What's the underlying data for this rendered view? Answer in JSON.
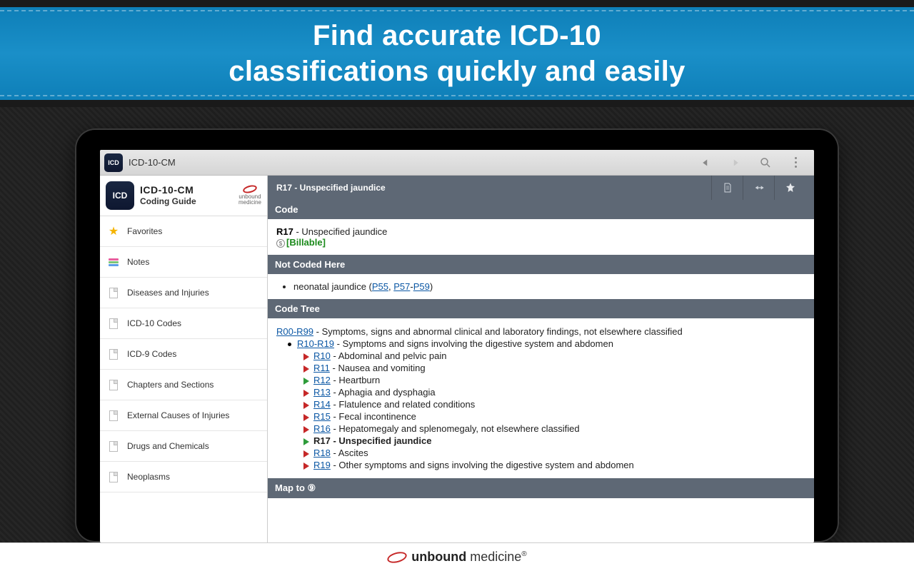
{
  "banner": {
    "line1": "Find accurate ICD-10",
    "line2": "classifications quickly and easily"
  },
  "appbar": {
    "icon_label": "ICD",
    "title": "ICD-10-CM"
  },
  "sidebar": {
    "icon_label": "ICD",
    "title": "ICD-10-CM",
    "subtitle": "Coding Guide",
    "logo_text": "unbound",
    "logo_sub": "medicine",
    "items": [
      {
        "label": "Favorites",
        "icon": "star"
      },
      {
        "label": "Notes",
        "icon": "notes"
      },
      {
        "label": "Diseases and Injuries",
        "icon": "page"
      },
      {
        "label": "ICD-10 Codes",
        "icon": "page"
      },
      {
        "label": "ICD-9 Codes",
        "icon": "page"
      },
      {
        "label": "Chapters and Sections",
        "icon": "page"
      },
      {
        "label": "External Causes of Injuries",
        "icon": "page"
      },
      {
        "label": "Drugs and Chemicals",
        "icon": "page"
      },
      {
        "label": "Neoplasms",
        "icon": "page"
      }
    ]
  },
  "topic": {
    "title": "R17 - Unspecified jaundice"
  },
  "sections": {
    "code": {
      "title": "Code",
      "code": "R17",
      "desc": " - Unspecified jaundice",
      "billable": "[Billable]"
    },
    "not_coded": {
      "title": "Not Coded Here",
      "prefix": "neonatal jaundice (",
      "links": [
        "P55",
        "P57",
        "P59"
      ],
      "sep1": ", ",
      "sep2": "-",
      "suffix": ")"
    },
    "code_tree": {
      "title": "Code Tree",
      "root": {
        "link": "R00-R99",
        "text": " - Symptoms, signs and abnormal clinical and laboratory findings, not elsewhere classified"
      },
      "sub": {
        "link": "R10-R19",
        "text": " - Symptoms and signs involving the digestive system and abdomen"
      },
      "items": [
        {
          "link": "R10",
          "text": " - Abdominal and pelvic pain",
          "color": "red"
        },
        {
          "link": "R11",
          "text": " - Nausea and vomiting",
          "color": "red"
        },
        {
          "link": "R12",
          "text": " - Heartburn",
          "color": "green"
        },
        {
          "link": "R13",
          "text": " - Aphagia and dysphagia",
          "color": "red"
        },
        {
          "link": "R14",
          "text": " - Flatulence and related conditions",
          "color": "red"
        },
        {
          "link": "R15",
          "text": " - Fecal incontinence",
          "color": "red"
        },
        {
          "link": "R16",
          "text": " - Hepatomegaly and splenomegaly, not elsewhere classified",
          "color": "red"
        },
        {
          "link": "",
          "text": "R17 - Unspecified jaundice",
          "color": "green",
          "bold": true
        },
        {
          "link": "R18",
          "text": " - Ascites",
          "color": "red"
        },
        {
          "link": "R19",
          "text": " - Other symptoms and signs involving the digestive system and abdomen",
          "color": "red"
        }
      ]
    },
    "map_to": {
      "title": "Map to ⑨"
    }
  },
  "footer": {
    "brand1": "unbound",
    "brand2": " medicine",
    "reg": "®"
  }
}
